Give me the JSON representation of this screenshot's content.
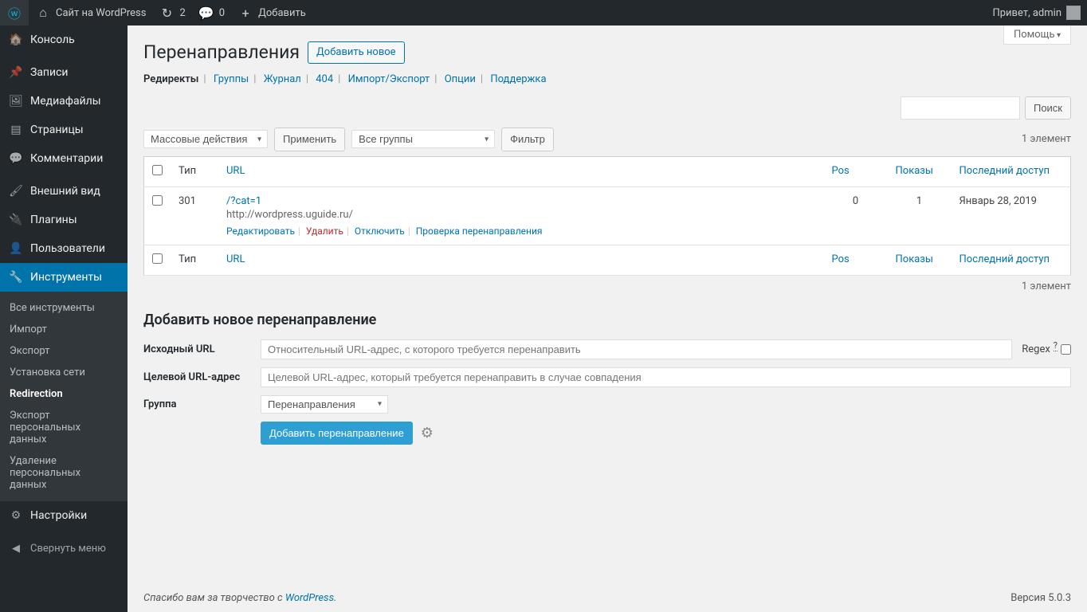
{
  "topbar": {
    "site_name": "Сайт на WordPress",
    "updates_count": "2",
    "comments_count": "0",
    "add_label": "Добавить",
    "greeting": "Привет, admin"
  },
  "sidebar": {
    "console": "Консоль",
    "posts": "Записи",
    "media": "Медиафайлы",
    "pages": "Страницы",
    "comments": "Комментарии",
    "appearance": "Внешний вид",
    "plugins": "Плагины",
    "users": "Пользователи",
    "tools": "Инструменты",
    "settings": "Настройки",
    "collapse": "Свернуть меню",
    "tools_sub": {
      "all": "Все инструменты",
      "import": "Импорт",
      "export": "Экспорт",
      "network": "Установка сети",
      "redirection": "Redirection",
      "privacy_export": "Экспорт персональных данных",
      "privacy_erase": "Удаление персональных данных"
    }
  },
  "help_label": "Помощь",
  "page_title": "Перенаправления",
  "add_new": "Добавить новое",
  "tabs": {
    "redirects": "Редиректы",
    "groups": "Группы",
    "log": "Журнал",
    "404": "404",
    "import_export": "Импорт/Экспорт",
    "options": "Опции",
    "support": "Поддержка"
  },
  "search": {
    "button": "Поиск",
    "value": ""
  },
  "bulk_select": "Массовые действия",
  "apply_btn": "Применить",
  "group_filter": "Все группы",
  "filter_btn": "Фильтр",
  "count_label": "1 элемент",
  "columns": {
    "type": "Тип",
    "url": "URL",
    "pos": "Pos",
    "hits": "Показы",
    "last": "Последний доступ"
  },
  "row": {
    "code": "301",
    "source": "/?cat=1",
    "target": "http://wordpress.uguide.ru/",
    "pos": "0",
    "hits": "1",
    "last": "Январь 28, 2019",
    "actions": {
      "edit": "Редактировать",
      "delete": "Удалить",
      "disable": "Отключить",
      "check": "Проверка перенаправления"
    }
  },
  "add_form": {
    "heading": "Добавить новое перенаправление",
    "source_label": "Исходный URL",
    "source_placeholder": "Относительный URL-адрес, с которого требуется перенаправить",
    "regex_label": "Regex",
    "target_label": "Целевой URL-адрес",
    "target_placeholder": "Целевой URL-адрес, который требуется перенаправить в случае совпадения",
    "group_label": "Группа",
    "group_value": "Перенаправления",
    "submit": "Добавить перенаправление"
  },
  "footer": {
    "thanks_pre": "Спасибо вам за творчество с ",
    "wp": "WordPress",
    "version": "Версия 5.0.3"
  }
}
